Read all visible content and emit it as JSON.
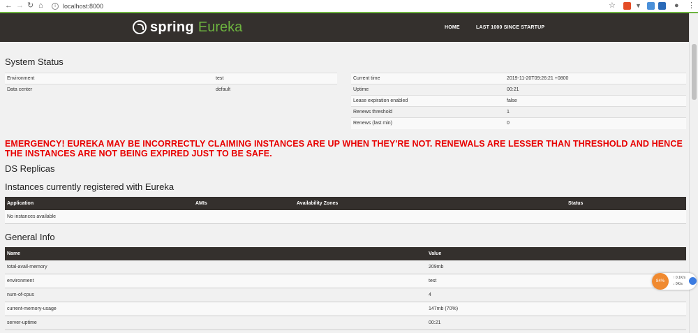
{
  "browser": {
    "url": "localhost:8000"
  },
  "nav": {
    "brand_spring": "spring",
    "brand_eureka": "Eureka",
    "home": "HOME",
    "last1000": "LAST 1000 SINCE STARTUP"
  },
  "system_status": {
    "title": "System Status",
    "left": [
      {
        "key": "Environment",
        "value": "test"
      },
      {
        "key": "Data center",
        "value": "default"
      }
    ],
    "right": [
      {
        "key": "Current time",
        "value": "2019-11-20T09:26:21 +0800"
      },
      {
        "key": "Uptime",
        "value": "00:21"
      },
      {
        "key": "Lease expiration enabled",
        "value": "false"
      },
      {
        "key": "Renews threshold",
        "value": "1"
      },
      {
        "key": "Renews (last min)",
        "value": "0"
      }
    ]
  },
  "emergency": "EMERGENCY! EUREKA MAY BE INCORRECTLY CLAIMING INSTANCES ARE UP WHEN THEY'RE NOT. RENEWALS ARE LESSER THAN THRESHOLD AND HENCE THE INSTANCES ARE NOT BEING EXPIRED JUST TO BE SAFE.",
  "ds_replicas": {
    "title": "DS Replicas"
  },
  "instances": {
    "title": "Instances currently registered with Eureka",
    "headers": [
      "Application",
      "AMIs",
      "Availability Zones",
      "Status"
    ],
    "empty": "No instances available"
  },
  "general_info": {
    "title": "General Info",
    "headers": [
      "Name",
      "Value"
    ],
    "rows": [
      {
        "name": "total-avail-memory",
        "value": "209mb"
      },
      {
        "name": "environment",
        "value": "test"
      },
      {
        "name": "num-of-cpus",
        "value": "4"
      },
      {
        "name": "current-memory-usage",
        "value": "147mb (70%)"
      },
      {
        "name": "server-uptime",
        "value": "00:21"
      }
    ]
  },
  "speed_widget": {
    "percent": "84%",
    "up": "0.1K/s",
    "down": "0K/s"
  },
  "colors": {
    "navbar": "#34302d",
    "spring_green": "#6db33f",
    "emergency_red": "#e80000"
  }
}
